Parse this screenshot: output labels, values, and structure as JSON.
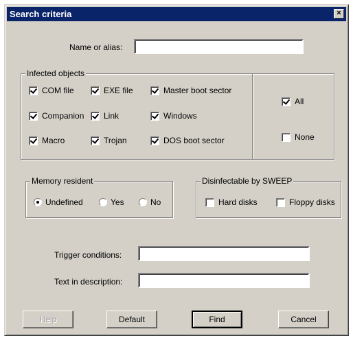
{
  "window": {
    "title": "Search criteria",
    "close_glyph": "×"
  },
  "name_alias": {
    "label": "Name or alias:",
    "value": ""
  },
  "infected_objects": {
    "legend": "Infected objects",
    "items": [
      {
        "label": "COM file",
        "checked": true
      },
      {
        "label": "EXE file",
        "checked": true
      },
      {
        "label": "Master boot sector",
        "checked": true
      },
      {
        "label": "Companion",
        "checked": true
      },
      {
        "label": "Link",
        "checked": true
      },
      {
        "label": "Windows",
        "checked": true
      },
      {
        "label": "Macro",
        "checked": true
      },
      {
        "label": "Trojan",
        "checked": true
      },
      {
        "label": "DOS boot sector",
        "checked": true
      }
    ],
    "all": {
      "label": "All",
      "checked": true
    },
    "none": {
      "label": "None",
      "checked": false
    }
  },
  "memory_resident": {
    "legend": "Memory resident",
    "options": [
      {
        "label": "Undefined",
        "selected": true
      },
      {
        "label": "Yes",
        "selected": false
      },
      {
        "label": "No",
        "selected": false
      }
    ]
  },
  "disinfectable": {
    "legend": "Disinfectable by SWEEP",
    "options": [
      {
        "label": "Hard disks",
        "checked": false
      },
      {
        "label": "Floppy disks",
        "checked": false
      }
    ]
  },
  "trigger": {
    "label": "Trigger conditions:",
    "value": ""
  },
  "description": {
    "label": "Text in description:",
    "value": ""
  },
  "buttons": {
    "help": "Help",
    "default": "Default",
    "find": "Find",
    "cancel": "Cancel"
  }
}
